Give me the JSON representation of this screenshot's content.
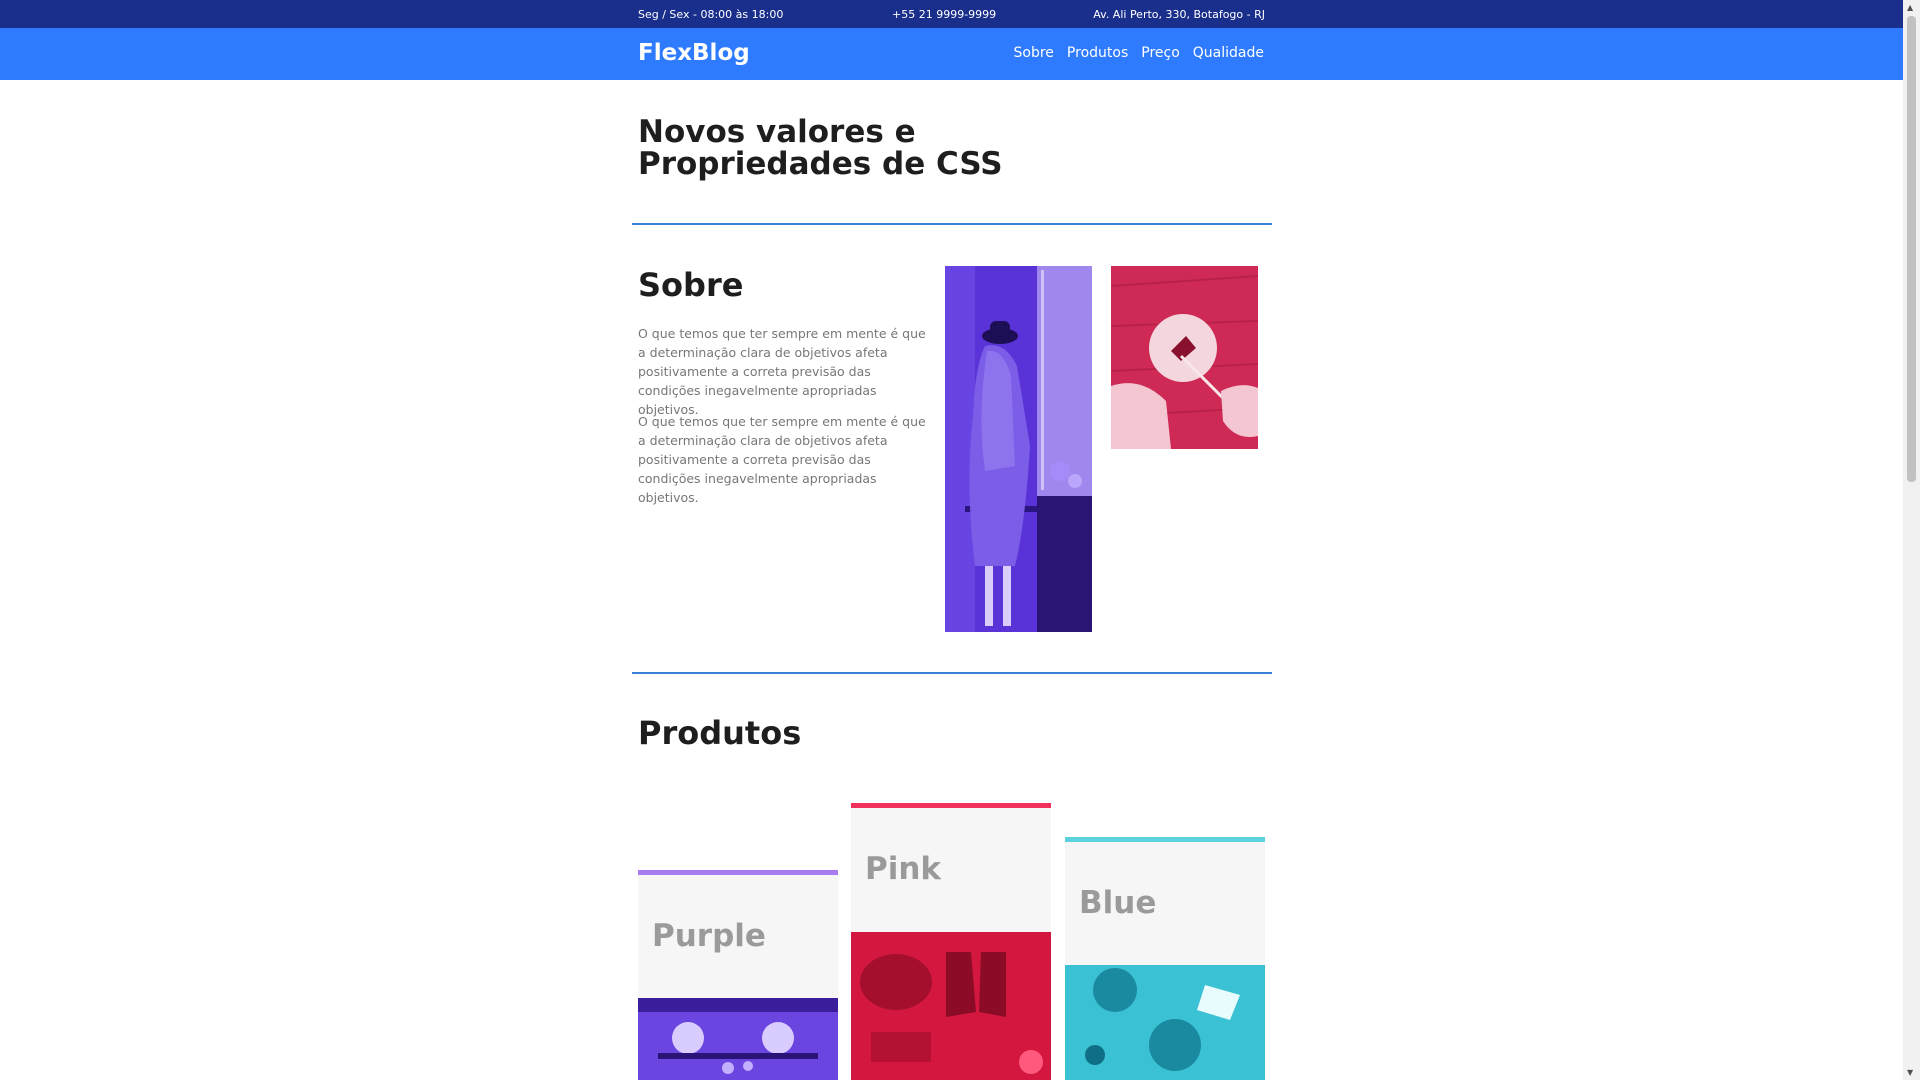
{
  "topbar": {
    "hours": "Seg / Sex - 08:00 às 18:00",
    "phone": "+55 21 9999-9999",
    "address": "Av. Ali Perto, 330, Botafogo - RJ"
  },
  "navbar": {
    "logo": "FlexBlog",
    "links": [
      "Sobre",
      "Produtos",
      "Preço",
      "Qualidade"
    ]
  },
  "hero": {
    "title": "Novos valores e Propriedades de CSS"
  },
  "sobre": {
    "title": "Sobre",
    "paragraphs": [
      "O que temos que ter sempre em mente é que a determinação clara de objetivos afeta positivamente a correta previsão das condições inegavelmente apropriadas objetivos.",
      "O que temos que ter sempre em mente é que a determinação clara de objetivos afeta positivamente a correta previsão das condições inegavelmente apropriadas objetivos."
    ]
  },
  "produtos": {
    "title": "Produtos",
    "cards": [
      {
        "label": "Purple",
        "color": "#a77cf0",
        "photo_color": "#6b45e0"
      },
      {
        "label": "Pink",
        "color": "#f0305d",
        "photo_color": "#d4173f"
      },
      {
        "label": "Blue",
        "color": "#5cd3dc",
        "photo_color": "#2ab7cf"
      }
    ]
  },
  "colors": {
    "topbar": "#1a2f8c",
    "navbar": "#2e7bff",
    "divider": "#3a7fd8"
  }
}
